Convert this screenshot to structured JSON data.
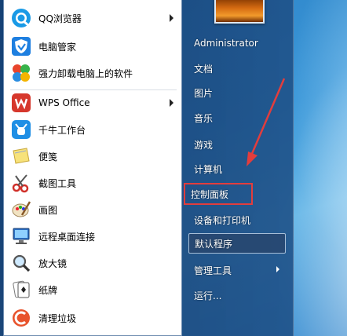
{
  "programs": [
    {
      "label": "QQ浏览器",
      "icon": "qq-browser-icon",
      "submenu": true
    },
    {
      "label": "电脑管家",
      "icon": "pc-manager-shield-icon",
      "submenu": false
    },
    {
      "label": "强力卸载电脑上的软件",
      "icon": "uninstall-icon",
      "submenu": false
    },
    {
      "label": "WPS Office",
      "icon": "wps-office-icon",
      "submenu": true
    },
    {
      "label": "千牛工作台",
      "icon": "qianniu-icon",
      "submenu": false
    },
    {
      "label": "便笺",
      "icon": "sticky-notes-icon",
      "submenu": false
    },
    {
      "label": "截图工具",
      "icon": "snipping-tool-icon",
      "submenu": false
    },
    {
      "label": "画图",
      "icon": "paint-icon",
      "submenu": false
    },
    {
      "label": "远程桌面连接",
      "icon": "remote-desktop-icon",
      "submenu": false
    },
    {
      "label": "放大镜",
      "icon": "magnifier-icon",
      "submenu": false
    },
    {
      "label": "纸牌",
      "icon": "solitaire-icon",
      "submenu": false
    },
    {
      "label": "清理垃圾",
      "icon": "cleanup-icon",
      "submenu": false
    }
  ],
  "user": {
    "name": "Administrator"
  },
  "links": [
    {
      "label": "文档",
      "state": "normal",
      "submenu": false
    },
    {
      "label": "图片",
      "state": "normal",
      "submenu": false
    },
    {
      "label": "音乐",
      "state": "normal",
      "submenu": false
    },
    {
      "label": "游戏",
      "state": "normal",
      "submenu": false
    },
    {
      "label": "计算机",
      "state": "normal",
      "submenu": false
    },
    {
      "label": "控制面板",
      "state": "annotated",
      "submenu": false
    },
    {
      "label": "设备和打印机",
      "state": "normal",
      "submenu": false
    },
    {
      "label": "默认程序",
      "state": "hover",
      "submenu": false
    },
    {
      "label": "管理工具",
      "state": "normal",
      "submenu": true
    },
    {
      "label": "运行...",
      "state": "normal",
      "submenu": false
    }
  ],
  "colors": {
    "annotation": "#e23d3d",
    "menu_text": "#ffffff"
  }
}
